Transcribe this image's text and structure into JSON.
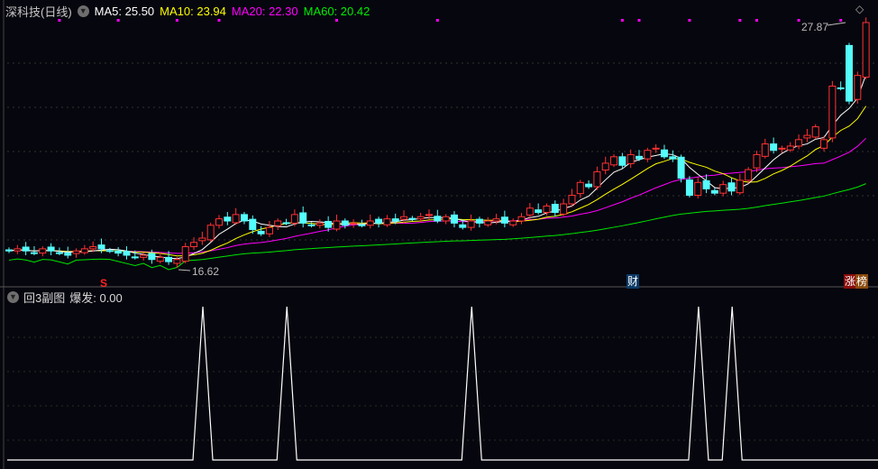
{
  "header": {
    "title": "深科技(日线)",
    "ma5": "MA5: 25.50",
    "ma10": "MA10: 23.94",
    "ma20": "MA20: 22.30",
    "ma60": "MA60: 20.42"
  },
  "colors": {
    "ma5": "#ffffff",
    "ma10": "#ffff00",
    "ma20": "#ff00ff",
    "ma60": "#00e600",
    "up": "#ff3232",
    "down": "#54fcfc",
    "bg": "#06060e"
  },
  "price": {
    "high_label": "27.87",
    "low_label": "16.62",
    "high": 27.87,
    "low": 16.62
  },
  "markers": {
    "s": "S",
    "cai": "财",
    "zhang": "涨",
    "bang": "榜"
  },
  "subchart": {
    "title": "回3副图",
    "indicator": "爆发: 0.00",
    "spike_candles": [
      22,
      32,
      54,
      81,
      85
    ]
  },
  "closes": [
    17.2,
    17.3,
    17.2,
    17.1,
    17.3,
    17.2,
    17.1,
    17.0,
    17.2,
    17.3,
    17.4,
    17.3,
    17.2,
    17.1,
    17.0,
    16.9,
    17.0,
    16.8,
    16.9,
    16.7,
    16.8,
    17.4,
    17.6,
    17.8,
    18.4,
    18.7,
    18.6,
    18.9,
    18.6,
    18.2,
    18.0,
    18.3,
    18.6,
    18.5,
    18.9,
    18.5,
    18.4,
    18.5,
    18.3,
    18.6,
    18.4,
    18.5,
    18.4,
    18.6,
    18.5,
    18.7,
    18.6,
    18.8,
    18.7,
    18.8,
    18.9,
    18.6,
    18.8,
    18.5,
    18.3,
    18.6,
    18.5,
    18.6,
    18.7,
    18.5,
    18.6,
    18.8,
    19.2,
    19.0,
    19.3,
    19.0,
    19.4,
    19.8,
    20.4,
    20.2,
    20.9,
    21.3,
    21.6,
    21.2,
    21.7,
    21.5,
    21.9,
    22.0,
    21.6,
    21.5,
    20.6,
    19.8,
    20.4,
    20.1,
    19.9,
    20.3,
    20.0,
    20.5,
    21.0,
    21.7,
    22.2,
    21.9,
    22.0,
    22.1,
    22.4,
    22.6,
    23.0,
    22.4,
    24.9,
    24.8,
    24.2,
    25.4,
    27.87
  ],
  "open_overrides": {
    "97": 22.0,
    "100": 26.8,
    "20": 16.62
  },
  "purple_dot_candles": [
    6,
    13,
    20,
    25,
    39,
    51,
    73,
    75,
    81,
    87,
    89,
    94,
    99
  ]
}
